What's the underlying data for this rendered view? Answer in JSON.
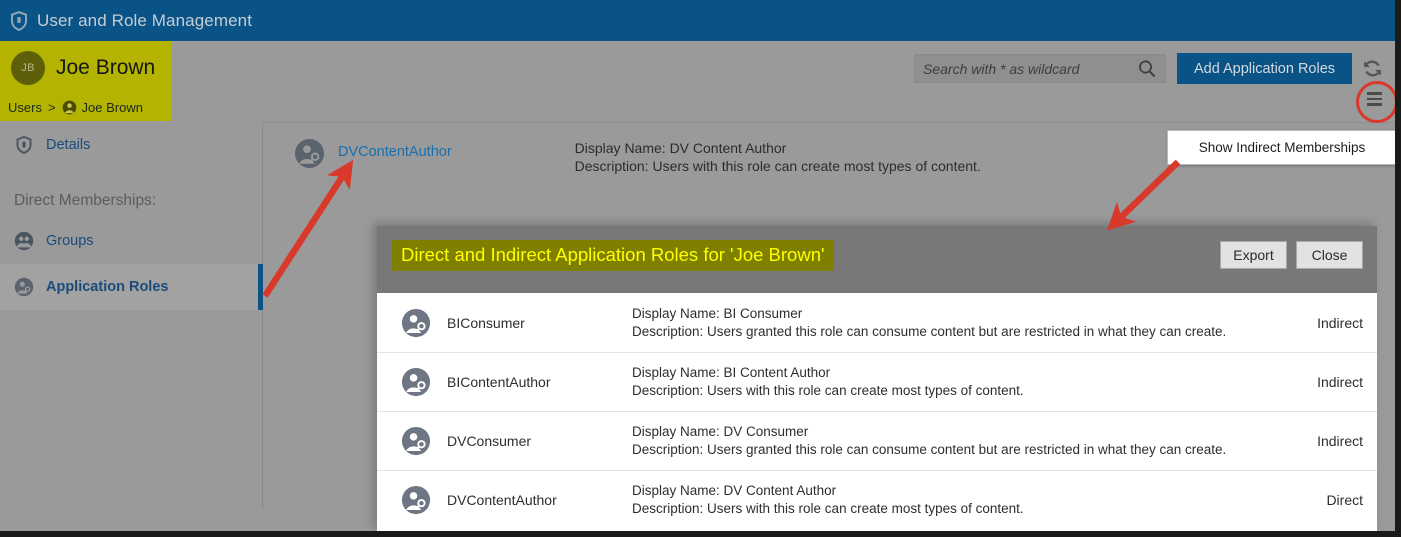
{
  "appbar": {
    "title": "User and Role Management",
    "icon": "shield-icon"
  },
  "user_header": {
    "initials": "JB",
    "name": "Joe Brown"
  },
  "breadcrumb": {
    "root": "Users",
    "separator": ">",
    "current": "Joe Brown"
  },
  "toolbar": {
    "search_placeholder": "Search with * as wildcard",
    "search_value": "",
    "add_roles_label": "Add Application Roles",
    "refresh_icon": "refresh-icon",
    "menu_icon": "hamburger-menu-icon"
  },
  "context_menu": {
    "items": [
      {
        "label": "Show Indirect Memberships"
      }
    ]
  },
  "sidebar": {
    "details_label": "Details",
    "section_heading": "Direct Memberships:",
    "items": [
      {
        "label": "Details",
        "icon": "shield-icon",
        "selected": false
      },
      {
        "label": "Groups",
        "icon": "groups-icon",
        "selected": false
      },
      {
        "label": "Application Roles",
        "icon": "application-role-icon",
        "selected": true
      }
    ]
  },
  "main": {
    "role": {
      "name": "DVContentAuthor",
      "display_name": "Display Name: DV Content Author",
      "description": "Description: Users with this role can create most types of content."
    }
  },
  "dialog": {
    "title": "Direct and Indirect Application Roles for 'Joe Brown'",
    "export_label": "Export",
    "close_label": "Close",
    "rows": [
      {
        "name": "BIConsumer",
        "display_name": "Display Name: BI Consumer",
        "description": "Description: Users granted this role can consume content but are restricted in what they can create.",
        "type": "Indirect"
      },
      {
        "name": "BIContentAuthor",
        "display_name": "Display Name: BI Content Author",
        "description": "Description: Users with this role can create most types of content.",
        "type": "Indirect"
      },
      {
        "name": "DVConsumer",
        "display_name": "Display Name: DV Consumer",
        "description": "Description: Users granted this role can consume content but are restricted in what they can create.",
        "type": "Indirect"
      },
      {
        "name": "DVContentAuthor",
        "display_name": "Display Name: DV Content Author",
        "description": "Description: Users with this role can create most types of content.",
        "type": "Direct"
      }
    ]
  },
  "colors": {
    "brand_blue": "#0a5387",
    "highlight_olive": "#b3b300",
    "title_highlight_bg": "#7f7f00",
    "title_highlight_fg": "#ffff00",
    "annotation_red": "#d8392b",
    "page_gray": "#9a9a9a",
    "dialog_header_gray": "#787878",
    "link_blue": "#1a6fad"
  }
}
